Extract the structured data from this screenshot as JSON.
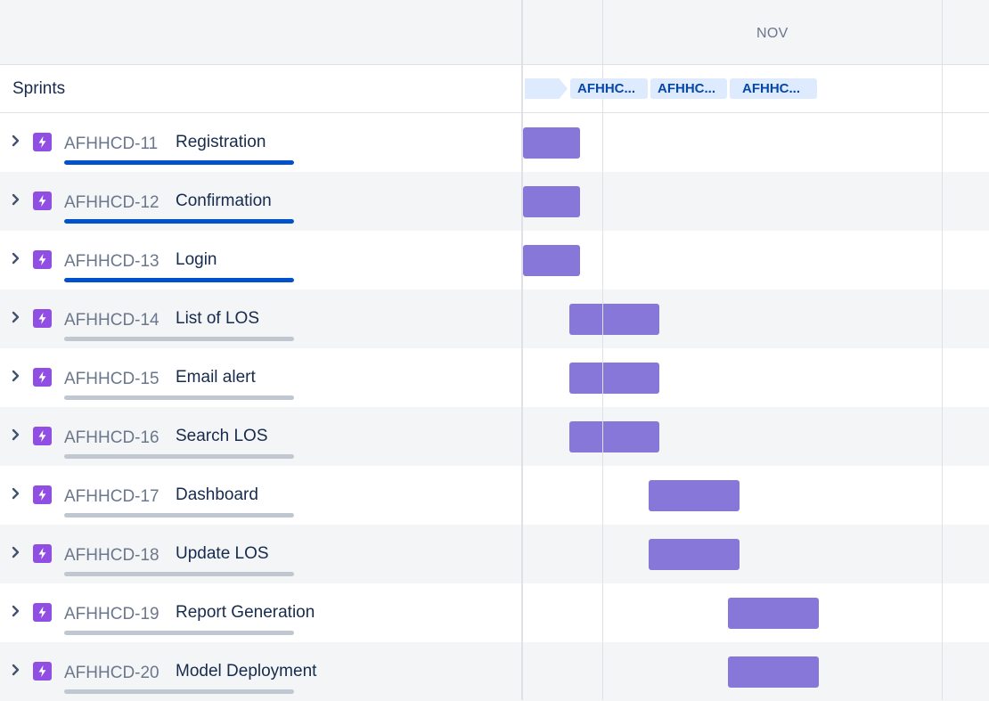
{
  "timeline": {
    "month_label": "NOV",
    "sprints_label": "Sprints",
    "sprints": [
      {
        "label": "AFHHC..."
      },
      {
        "label": "AFHHC..."
      },
      {
        "label": "AFHHC..."
      }
    ]
  },
  "colors": {
    "bar": "#8777d9",
    "progress_done": "#0052cc",
    "progress_track": "#c1c7d0",
    "issue_icon": "#904ee2",
    "sprint_chip_bg": "#deebff",
    "sprint_chip_text": "#0747a6"
  },
  "issues": [
    {
      "key": "AFHHCD-11",
      "summary": "Registration",
      "icon": "epic-lightning-icon",
      "progress": 1.0
    },
    {
      "key": "AFHHCD-12",
      "summary": "Confirmation",
      "icon": "epic-lightning-icon",
      "progress": 1.0
    },
    {
      "key": "AFHHCD-13",
      "summary": "Login",
      "icon": "epic-lightning-icon",
      "progress": 1.0
    },
    {
      "key": "AFHHCD-14",
      "summary": "List of LOS",
      "icon": "epic-lightning-icon",
      "progress": 0.0
    },
    {
      "key": "AFHHCD-15",
      "summary": "Email alert",
      "icon": "epic-lightning-icon",
      "progress": 0.0
    },
    {
      "key": "AFHHCD-16",
      "summary": "Search LOS",
      "icon": "epic-lightning-icon",
      "progress": 0.0
    },
    {
      "key": "AFHHCD-17",
      "summary": "Dashboard",
      "icon": "epic-lightning-icon",
      "progress": 0.0
    },
    {
      "key": "AFHHCD-18",
      "summary": "Update LOS",
      "icon": "epic-lightning-icon",
      "progress": 0.0
    },
    {
      "key": "AFHHCD-19",
      "summary": "Report Generation",
      "icon": "epic-lightning-icon",
      "progress": 0.0
    },
    {
      "key": "AFHHCD-20",
      "summary": "Model Deployment",
      "icon": "epic-lightning-icon",
      "progress": 0.0
    }
  ]
}
